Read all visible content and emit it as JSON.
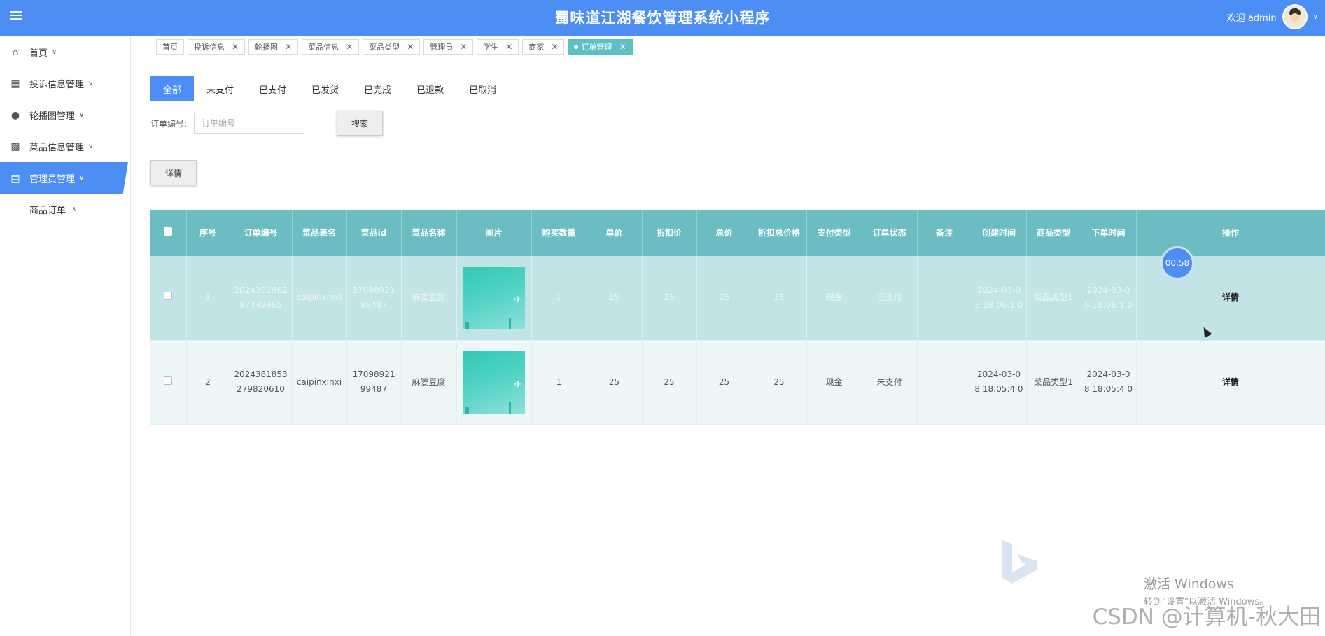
{
  "header": {
    "title": "蜀味道江湖餐饮管理系统小程序",
    "welcome": "欢迎 admin"
  },
  "sidebar": {
    "items": [
      {
        "label": "首页",
        "icon": "home-icon"
      },
      {
        "label": "投诉信息管理",
        "icon": "grid-icon"
      },
      {
        "label": "轮播图管理",
        "icon": "mouse-icon"
      },
      {
        "label": "菜品信息管理",
        "icon": "toolbox-icon"
      },
      {
        "label": "管理员管理",
        "icon": "chart-icon"
      }
    ],
    "sub_item": "商品订单"
  },
  "tabs": [
    "首页",
    "投诉信息",
    "轮播图",
    "菜品信息",
    "菜品类型",
    "管理员",
    "学生",
    "商家",
    "订单管理"
  ],
  "status_tabs": [
    "全部",
    "未支付",
    "已支付",
    "已发货",
    "已完成",
    "已退款",
    "已取消"
  ],
  "search": {
    "label": "订单编号:",
    "placeholder": "订单编号",
    "button": "搜索"
  },
  "detail_button": "详情",
  "table": {
    "headers": [
      "序号",
      "订单编号",
      "菜品表名",
      "菜品id",
      "菜品名称",
      "图片",
      "购买数量",
      "单价",
      "折扣价",
      "总价",
      "折扣总价格",
      "支付类型",
      "订单状态",
      "备注",
      "创建时间",
      "商品类型",
      "下单时间",
      "操作"
    ],
    "rows": [
      {
        "index": "1",
        "order_no": "2024381862 97449965",
        "table_name": "caipinxinxi",
        "dish_id": "17098921 99487",
        "dish_name": "麻婆豆腐",
        "qty": "1",
        "price": "25",
        "discount_price": "25",
        "total": "25",
        "discount_total": "25",
        "pay_type": "现金",
        "status": "已支付",
        "remark": "",
        "created": "2024-03-0 8 18:06:1 0",
        "category": "菜品类型1",
        "ordered": "2024-03-0 8 18:06:1 0",
        "action": "详情"
      },
      {
        "index": "2",
        "order_no": "2024381853 279820610",
        "table_name": "caipinxinxi",
        "dish_id": "17098921 99487",
        "dish_name": "麻婆豆腐",
        "qty": "1",
        "price": "25",
        "discount_price": "25",
        "total": "25",
        "discount_total": "25",
        "pay_type": "现金",
        "status": "未支付",
        "remark": "",
        "created": "2024-03-0 8 18:05:4 0",
        "category": "菜品类型1",
        "ordered": "2024-03-0 8 18:05:4 0",
        "action": "详情"
      }
    ]
  },
  "timer": "00:58",
  "watermark": {
    "title": "激活 Windows",
    "subtitle": "转到\"设置\"以激活 Windows。",
    "csdn": "CSDN @计算机-秋大田"
  },
  "colors": {
    "primary": "#4d8ef5",
    "table_header": "#6cbdc2",
    "active_tab": "#5ec0c6"
  }
}
